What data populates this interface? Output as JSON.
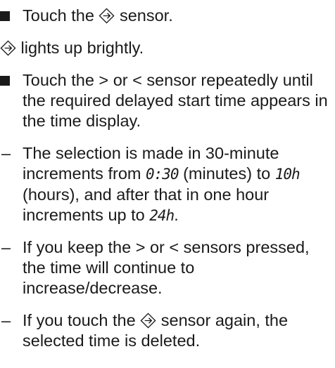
{
  "icons": {
    "delay_sensor": "delayed-start-sensor-icon"
  },
  "step1": {
    "marker": "■",
    "before": "Touch the",
    "after": "sensor."
  },
  "result1": {
    "after": "lights up brightly."
  },
  "step2": {
    "marker": "■",
    "text": "Touch the > or < sensor repeatedly until the required delayed start time appears in the time display."
  },
  "note1": {
    "marker": "–",
    "part1": "The selection is made in 30-minute increments from",
    "value1": "0:30",
    "part2": "(minutes) to",
    "value2": "10h",
    "part3": "(hours), and after that in one hour increments up to",
    "value3": "24h",
    "part4": "."
  },
  "note2": {
    "marker": "–",
    "text": "If you keep the > or < sensors pressed, the time will continue to increase/decrease."
  },
  "note3": {
    "marker": "–",
    "before": "If you touch the",
    "after": "sensor again, the selected time is deleted."
  }
}
